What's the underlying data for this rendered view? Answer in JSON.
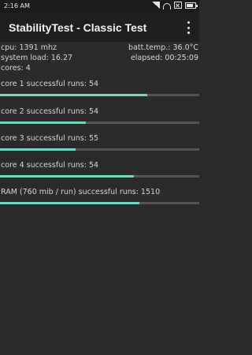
{
  "status_bar": {
    "time": "2:16 AM",
    "icons": [
      "signal-icon",
      "wifi-icon",
      "notification-box-icon",
      "battery-icon"
    ]
  },
  "app_bar": {
    "title": "StabilityTest - Classic Test",
    "menu_icon": "overflow-menu-icon"
  },
  "stats": {
    "cpu": "cpu: 1391 mhz",
    "batt_temp": "batt.temp.: 36.0°C",
    "system_load": "system load: 16.27",
    "elapsed": "elapsed: 00:25:09",
    "cores": "cores: 4"
  },
  "progress_items": [
    {
      "label": "core 1 successful runs: 54",
      "progress": 0.74
    },
    {
      "label": "core 2 successful runs: 54",
      "progress": 0.43
    },
    {
      "label": "core 3 successful runs: 55",
      "progress": 0.38
    },
    {
      "label": "core 4 successful runs: 54",
      "progress": 0.67
    },
    {
      "label": "RAM (760 mib / run) successful runs: 1510",
      "progress": 0.7
    }
  ],
  "colors": {
    "background": "#2b2b2b",
    "app_bar": "#1f1f1f",
    "progress_fill": "#79d5c3",
    "progress_track": "#555555"
  }
}
